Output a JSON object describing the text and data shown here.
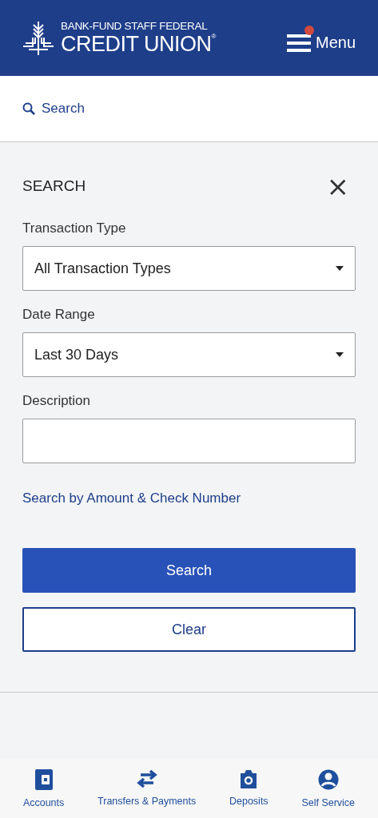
{
  "header": {
    "logo_top": "BANK-FUND STAFF FEDERAL",
    "logo_bottom": "CREDIT UNION",
    "logo_mark": "®",
    "menu_label": "Menu",
    "menu_notification": true
  },
  "search_bar": {
    "label": "Search"
  },
  "panel": {
    "title": "SEARCH",
    "close": "×",
    "fields": [
      {
        "kind": "select",
        "label": "Transaction Type",
        "value": "All Transaction Types"
      },
      {
        "kind": "select",
        "label": "Date Range",
        "value": "Last 30 Days"
      },
      {
        "kind": "text",
        "label": "Description"
      }
    ],
    "link": "Search by Amount & Check Number",
    "primary_button": "Search",
    "secondary_button": "Clear"
  },
  "bottom_nav": [
    {
      "kind": "wallet",
      "label": "Accounts"
    },
    {
      "kind": "transfer",
      "label": "Transfers & Payments"
    },
    {
      "kind": "camera",
      "label": "Deposits"
    },
    {
      "kind": "user",
      "label": "Self Service"
    }
  ]
}
